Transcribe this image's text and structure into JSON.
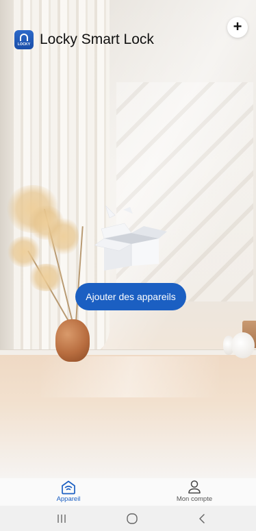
{
  "header": {
    "app_title": "Locky Smart Lock",
    "logo_text": "LOCKY",
    "add_icon": "plus-icon"
  },
  "empty_state": {
    "icon": "empty-box-icon",
    "button_label": "Ajouter des appareils"
  },
  "bottom_nav": {
    "items": [
      {
        "label": "Appareil",
        "icon": "home-icon",
        "active": true
      },
      {
        "label": "Mon compte",
        "icon": "user-icon",
        "active": false
      }
    ]
  },
  "system_nav": {
    "buttons": [
      "recents-icon",
      "home-circle-icon",
      "back-icon"
    ]
  },
  "colors": {
    "accent": "#1b5fc2",
    "title_text": "#111111"
  }
}
